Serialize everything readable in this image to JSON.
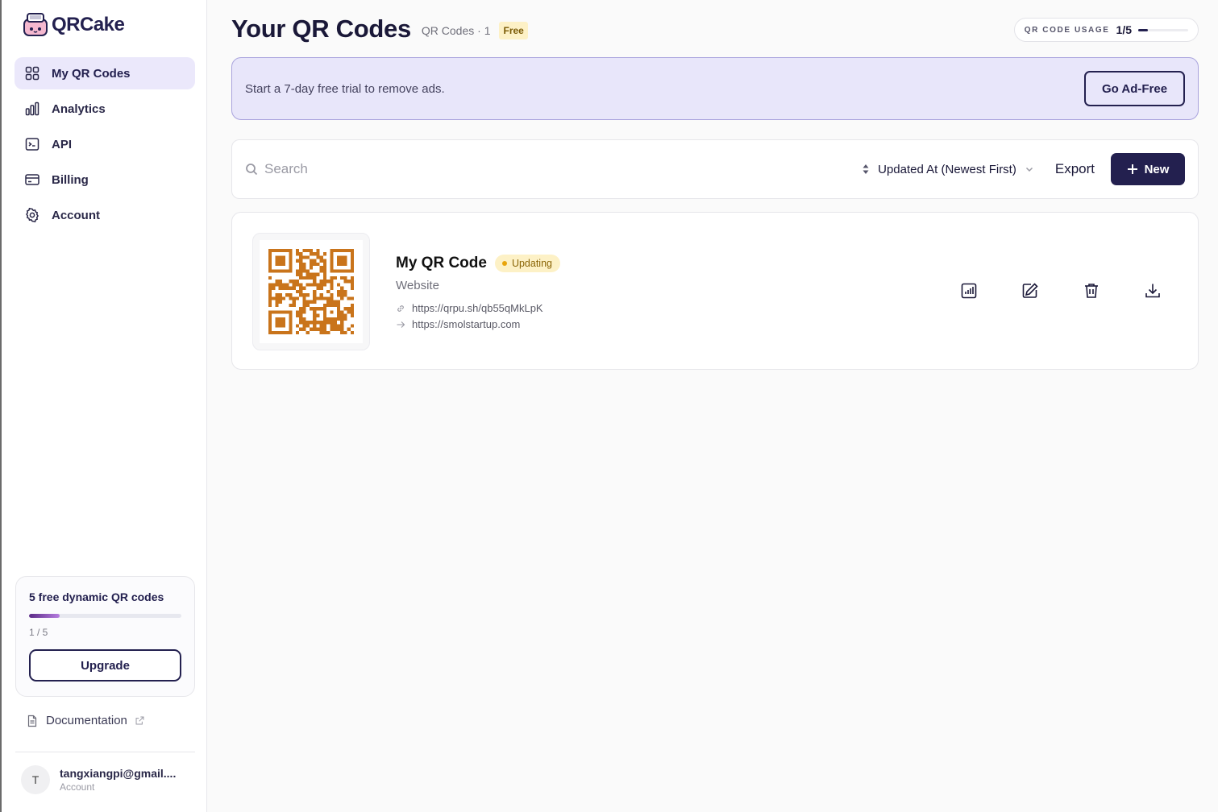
{
  "app": {
    "name": "QRCake"
  },
  "sidebar": {
    "items": [
      {
        "label": "My QR Codes",
        "icon": "grid-icon",
        "active": true
      },
      {
        "label": "Analytics",
        "icon": "bar-chart-icon"
      },
      {
        "label": "API",
        "icon": "terminal-icon"
      },
      {
        "label": "Billing",
        "icon": "credit-card-icon"
      },
      {
        "label": "Account",
        "icon": "gear-icon"
      }
    ],
    "promo": {
      "title": "5 free dynamic QR codes",
      "count": "1 / 5",
      "progress": 0.2,
      "button": "Upgrade"
    },
    "documentation": "Documentation",
    "user": {
      "initial": "T",
      "email": "tangxiangpi@gmail....",
      "sub": "Account"
    }
  },
  "header": {
    "title": "Your QR Codes",
    "meta": "QR Codes · 1",
    "badge": "Free",
    "usage_label": "QR CODE USAGE",
    "usage_value": "1/5",
    "usage_progress": 0.2
  },
  "banner": {
    "text": "Start a 7-day free trial to remove ads.",
    "button": "Go Ad-Free"
  },
  "toolbar": {
    "search_placeholder": "Search",
    "sort_label": "Updated At (Newest First)",
    "export_label": "Export",
    "new_label": "New"
  },
  "qr_card": {
    "title": "My QR Code",
    "status": "Updating",
    "type": "Website",
    "short_url": "https://qrpu.sh/qb55qMkLpK",
    "destination_url": "https://smolstartup.com",
    "qr_color": "#c9741b"
  },
  "colors": {
    "brand": "#23204f",
    "accent_bg": "#e8e6fa",
    "badge_bg": "#fdf1c6",
    "status_dot": "#e8a40a"
  }
}
